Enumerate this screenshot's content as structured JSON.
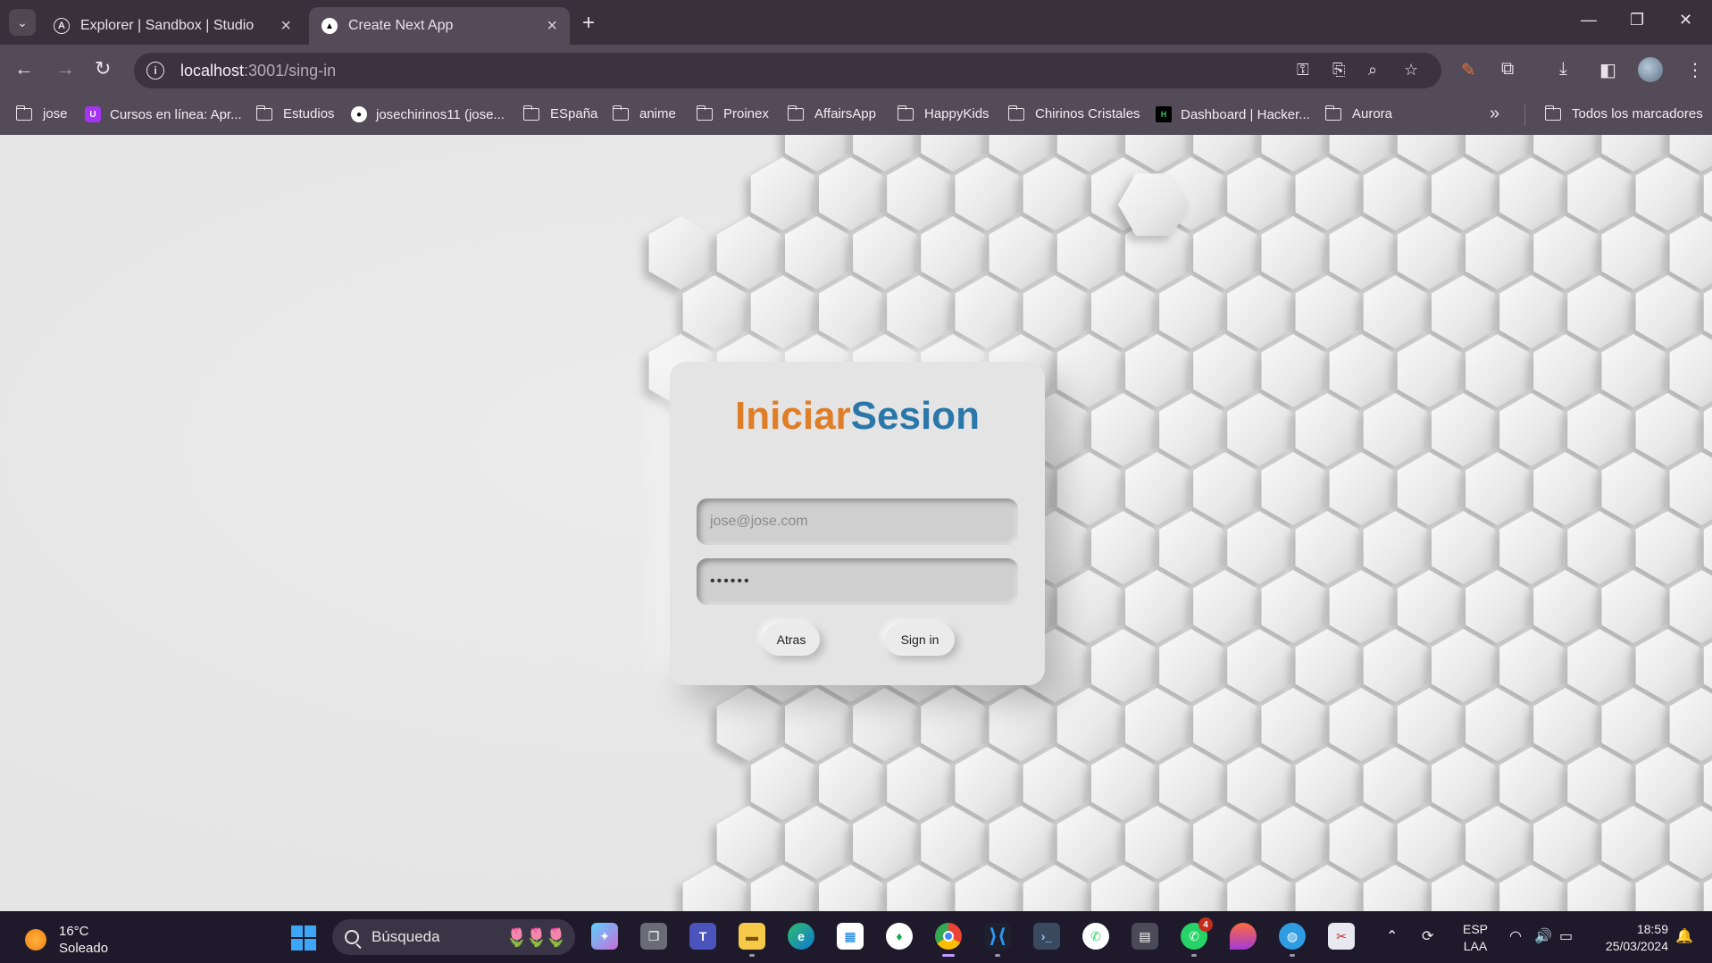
{
  "browser": {
    "tabs": [
      {
        "title": "Explorer | Sandbox | Studio",
        "active": false
      },
      {
        "title": "Create Next App",
        "active": true
      }
    ],
    "url": {
      "host": "localhost",
      "path": ":3001/sing-in"
    },
    "bookmarks": [
      {
        "label": "jose",
        "icon": "folder-icon"
      },
      {
        "label": "Cursos en línea: Apr...",
        "icon": "udemy-icon"
      },
      {
        "label": "Estudios",
        "icon": "folder-icon"
      },
      {
        "label": "josechirinos11 (jose...",
        "icon": "github-icon"
      },
      {
        "label": "ESpaña",
        "icon": "folder-icon"
      },
      {
        "label": "anime",
        "icon": "folder-icon"
      },
      {
        "label": "Proinex",
        "icon": "folder-icon"
      },
      {
        "label": "AffairsApp",
        "icon": "folder-icon"
      },
      {
        "label": "HappyKids",
        "icon": "folder-icon"
      },
      {
        "label": "Chirinos Cristales",
        "icon": "folder-icon"
      },
      {
        "label": "Dashboard | Hacker...",
        "icon": "hackerrank-icon"
      },
      {
        "label": "Aurora",
        "icon": "folder-icon"
      }
    ],
    "all_bookmarks": "Todos los marcadores"
  },
  "login": {
    "title_part1": "Iniciar",
    "title_part2": "Sesion",
    "email_placeholder": "jose@jose.com",
    "password_value": "123456",
    "back_label": "Atras",
    "signin_label": "Sign in",
    "colors": {
      "title_part1": "#e07d27",
      "title_part2": "#2a77a9"
    }
  },
  "taskbar": {
    "weather_temp": "16°C",
    "weather_desc": "Soleado",
    "search_placeholder": "Búsqueda",
    "whatsapp_badge": "4",
    "lang_top": "ESP",
    "lang_bottom": "LAA",
    "time": "18:59",
    "date": "25/03/2024"
  }
}
